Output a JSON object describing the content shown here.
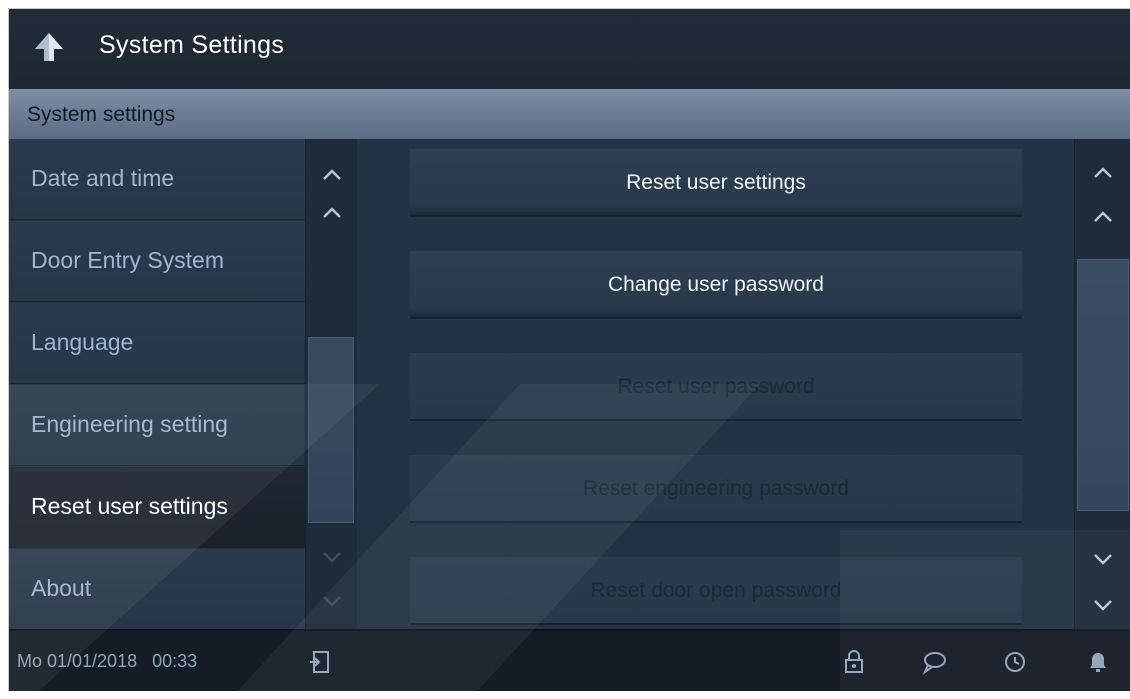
{
  "header": {
    "title": "System Settings",
    "back_icon": "back-arrow-icon"
  },
  "subheader": {
    "title": "System settings"
  },
  "menu": {
    "items": [
      {
        "label": "Date and time"
      },
      {
        "label": "Door Entry System"
      },
      {
        "label": "Language"
      },
      {
        "label": "Engineering setting"
      },
      {
        "label": "Reset user settings"
      },
      {
        "label": "About"
      }
    ],
    "active": "Reset user settings"
  },
  "content": {
    "buttons": [
      {
        "label": "Reset user settings",
        "enabled": true
      },
      {
        "label": "Change user password",
        "enabled": true
      },
      {
        "label": "Reset user password",
        "enabled": false
      },
      {
        "label": "Reset engineering password",
        "enabled": false
      },
      {
        "label": "Reset door open password",
        "enabled": false
      }
    ]
  },
  "status": {
    "date": "Mo 01/01/2018",
    "time": "00:33",
    "icons": [
      "exit-icon",
      "lock-icon",
      "message-icon",
      "history-icon",
      "bell-icon"
    ]
  },
  "colors": {
    "accent_text": "#9cb7d0",
    "header_bar": "#6c7f96",
    "background": "#233345"
  }
}
